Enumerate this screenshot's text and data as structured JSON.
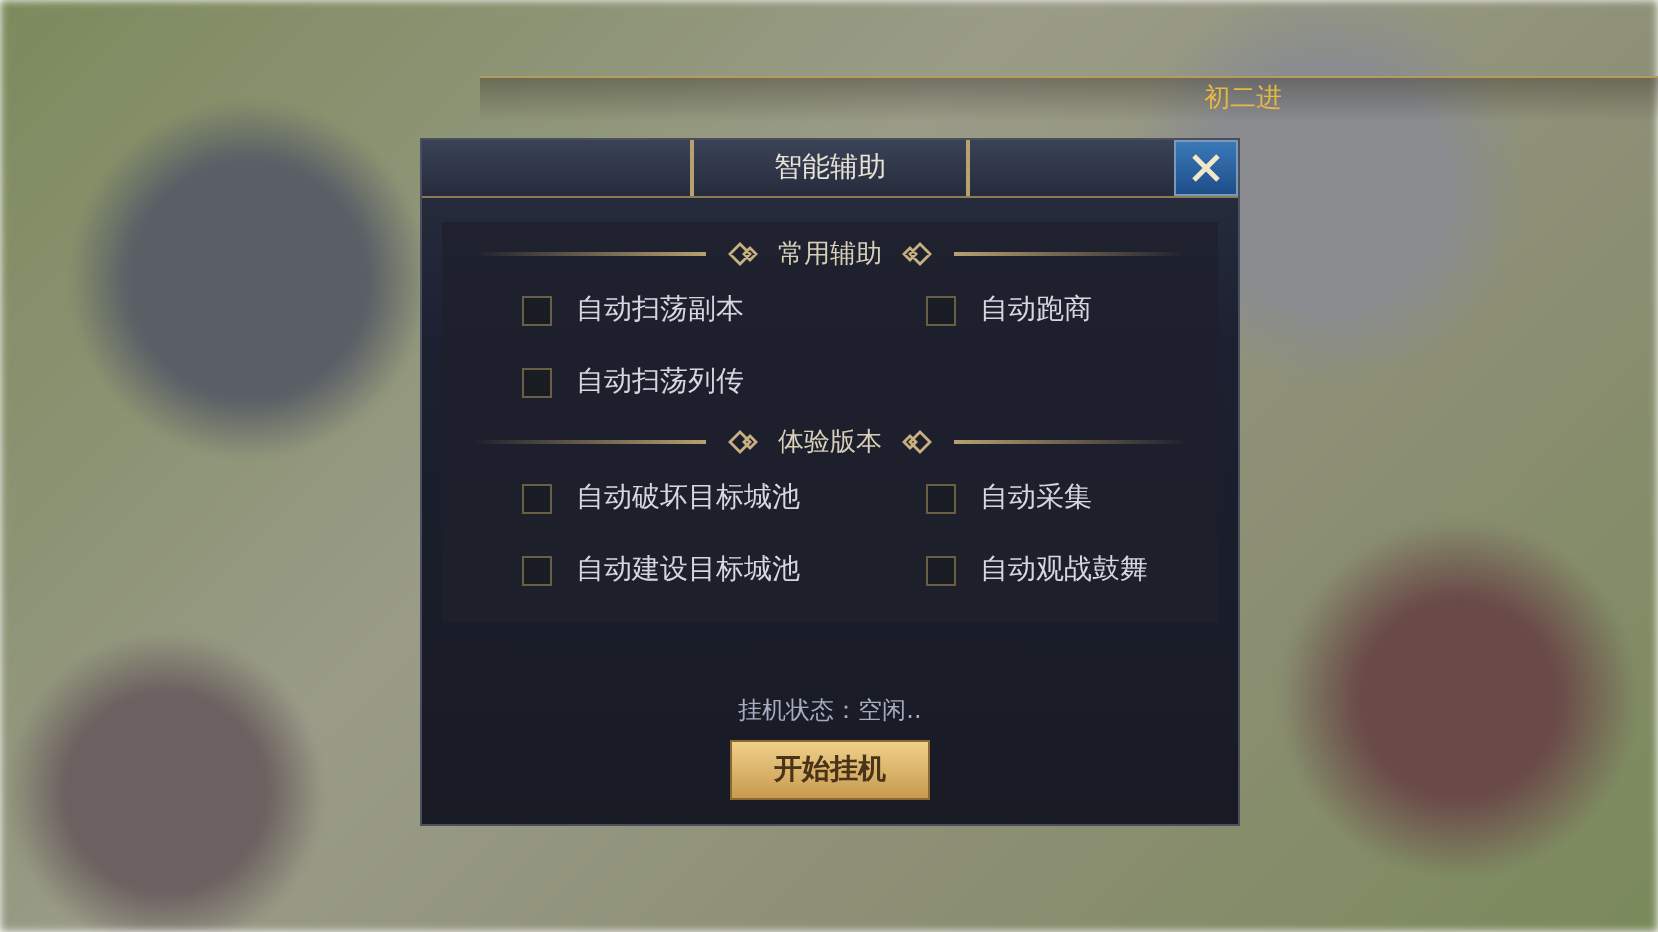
{
  "top_bar": {
    "text": "初二进"
  },
  "dialog": {
    "title": "智能辅助",
    "sections": [
      {
        "title": "常用辅助",
        "options": [
          {
            "label": "自动扫荡副本",
            "checked": false
          },
          {
            "label": "自动跑商",
            "checked": false
          },
          {
            "label": "自动扫荡列传",
            "checked": false
          }
        ]
      },
      {
        "title": "体验版本",
        "options": [
          {
            "label": "自动破坏目标城池",
            "checked": false
          },
          {
            "label": "自动采集",
            "checked": false
          },
          {
            "label": "自动建设目标城池",
            "checked": false
          },
          {
            "label": "自动观战鼓舞",
            "checked": false
          }
        ]
      }
    ],
    "status": "挂机状态：空闲..",
    "start_button": "开始挂机"
  }
}
